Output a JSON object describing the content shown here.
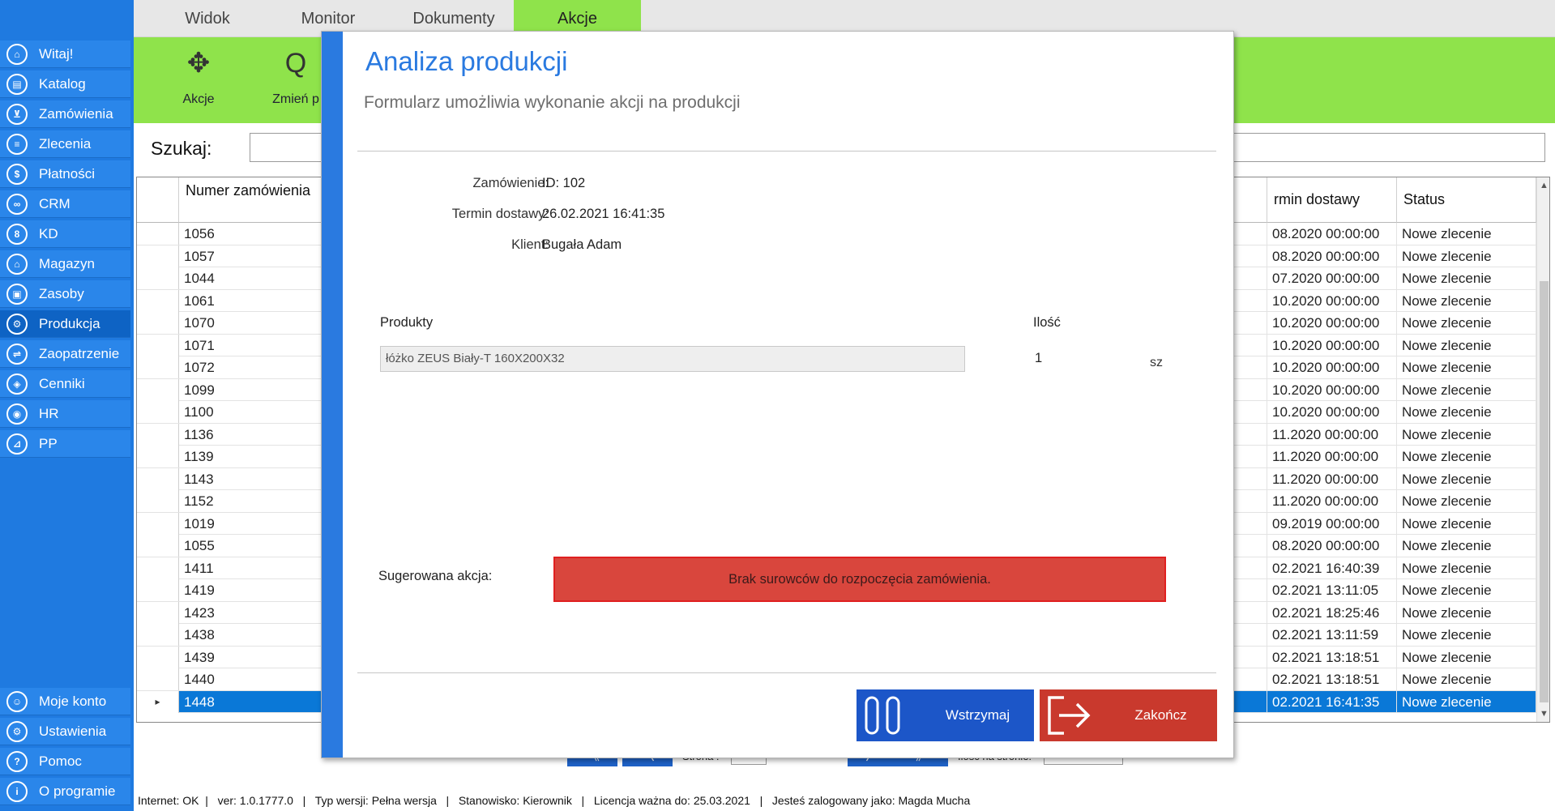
{
  "sidebar": {
    "items": [
      {
        "label": "Witaj!",
        "icon": "home-icon",
        "glyph": "⌂"
      },
      {
        "label": "Katalog",
        "icon": "book-icon",
        "glyph": "▤"
      },
      {
        "label": "Zamówienia",
        "icon": "cart-icon",
        "glyph": "⊻"
      },
      {
        "label": "Zlecenia",
        "icon": "list-icon",
        "glyph": "≡"
      },
      {
        "label": "Płatności",
        "icon": "dollar-icon",
        "glyph": "$"
      },
      {
        "label": "CRM",
        "icon": "crm-icon",
        "glyph": "∞"
      },
      {
        "label": "KD",
        "icon": "user-badge-icon",
        "glyph": "8"
      },
      {
        "label": "Magazyn",
        "icon": "warehouse-icon",
        "glyph": "⌂"
      },
      {
        "label": "Zasoby",
        "icon": "box-icon",
        "glyph": "▣"
      },
      {
        "label": "Produkcja",
        "icon": "production-icon",
        "glyph": "⚙"
      },
      {
        "label": "Zaopatrzenie",
        "icon": "truck-icon",
        "glyph": "⇌"
      },
      {
        "label": "Cenniki",
        "icon": "tag-icon",
        "glyph": "◈"
      },
      {
        "label": "HR",
        "icon": "hr-icon",
        "glyph": "◉"
      },
      {
        "label": "PP",
        "icon": "pp-icon",
        "glyph": "⊿"
      }
    ],
    "bottom_items": [
      {
        "label": "Moje konto",
        "icon": "account-icon",
        "glyph": "☺"
      },
      {
        "label": "Ustawienia",
        "icon": "settings-icon",
        "glyph": "⚙"
      },
      {
        "label": "Pomoc",
        "icon": "help-icon",
        "glyph": "?"
      },
      {
        "label": "O programie",
        "icon": "info-icon",
        "glyph": "i"
      }
    ]
  },
  "menubar": {
    "tabs": [
      {
        "label": "Widok"
      },
      {
        "label": "Monitor"
      },
      {
        "label": "Dokumenty"
      },
      {
        "label": "Akcje"
      }
    ]
  },
  "ribbon": {
    "actions_label": "Akcje",
    "actions_glyph": "✥",
    "change_label": "Zmień p",
    "change_glyph": "Q"
  },
  "search": {
    "label": "Szukaj:",
    "value": ""
  },
  "table": {
    "col_number_header": "Numer zamówienia",
    "col_delivery_header": "rmin dostawy",
    "col_status_header": "Status",
    "rows": [
      {
        "number": "1056",
        "delivery": "08.2020 00:00:00",
        "status": "Nowe zlecenie"
      },
      {
        "number": "1057",
        "delivery": "08.2020 00:00:00",
        "status": "Nowe zlecenie"
      },
      {
        "number": "1044",
        "delivery": "07.2020 00:00:00",
        "status": "Nowe zlecenie"
      },
      {
        "number": "1061",
        "delivery": "10.2020 00:00:00",
        "status": "Nowe zlecenie"
      },
      {
        "number": "1070",
        "delivery": "10.2020 00:00:00",
        "status": "Nowe zlecenie"
      },
      {
        "number": "1071",
        "delivery": "10.2020 00:00:00",
        "status": "Nowe zlecenie"
      },
      {
        "number": "1072",
        "delivery": "10.2020 00:00:00",
        "status": "Nowe zlecenie"
      },
      {
        "number": "1099",
        "delivery": "10.2020 00:00:00",
        "status": "Nowe zlecenie"
      },
      {
        "number": "1100",
        "delivery": "10.2020 00:00:00",
        "status": "Nowe zlecenie"
      },
      {
        "number": "1136",
        "delivery": "11.2020 00:00:00",
        "status": "Nowe zlecenie"
      },
      {
        "number": "1139",
        "delivery": "11.2020 00:00:00",
        "status": "Nowe zlecenie"
      },
      {
        "number": "1143",
        "delivery": "11.2020 00:00:00",
        "status": "Nowe zlecenie"
      },
      {
        "number": "1152",
        "delivery": "11.2020 00:00:00",
        "status": "Nowe zlecenie"
      },
      {
        "number": "1019",
        "delivery": "09.2019 00:00:00",
        "status": "Nowe zlecenie"
      },
      {
        "number": "1055",
        "delivery": "08.2020 00:00:00",
        "status": "Nowe zlecenie"
      },
      {
        "number": "1411",
        "delivery": "02.2021 16:40:39",
        "status": "Nowe zlecenie"
      },
      {
        "number": "1419",
        "delivery": "02.2021 13:11:05",
        "status": "Nowe zlecenie"
      },
      {
        "number": "1423",
        "delivery": "02.2021 18:25:46",
        "status": "Nowe zlecenie"
      },
      {
        "number": "1438",
        "delivery": "02.2021 13:11:59",
        "status": "Nowe zlecenie"
      },
      {
        "number": "1439",
        "delivery": "02.2021 13:18:51",
        "status": "Nowe zlecenie"
      },
      {
        "number": "1440",
        "delivery": "02.2021 13:18:51",
        "status": "Nowe zlecenie"
      },
      {
        "number": "1448",
        "delivery": "02.2021 16:41:35",
        "status": "Nowe zlecenie",
        "selected": true
      }
    ],
    "selected_row_marker": "▸"
  },
  "pager": {
    "first_glyph": "《",
    "prev_glyph": "〈",
    "next_glyph": "〉",
    "last_glyph": "》",
    "page_label": "Strona :",
    "per_page_label": "Ilość na stronie:"
  },
  "statusbar": {
    "text": "Internet: OK  |   ver: 1.0.1777.0   |   Typ wersji: Pełna wersja   |   Stanowisko: Kierownik   |   Licencja ważna do: 25.03.2021   |   Jesteś zalogowany jako: Magda Mucha"
  },
  "modal": {
    "title": "Analiza produkcji",
    "subtitle": "Formularz umożliwia wykonanie akcji na produkcji",
    "order_label": "Zamówienie:",
    "order_value": "ID: 102",
    "delivery_label": "Termin dostawy:",
    "delivery_value": "26.02.2021 16:41:35",
    "client_label": "Klient:",
    "client_value": "Bugała Adam",
    "products_header": "Produkty",
    "quantity_header": "Ilość",
    "product_value": "łóżko ZEUS Biały-T 160X200X32",
    "quantity_value": "1",
    "unit_value": "sz",
    "suggested_label": "Sugerowana akcja:",
    "suggested_action": "Brak surowców do rozpoczęcia zamówienia.",
    "pause_label": "Wstrzymaj",
    "finish_label": "Zakończ"
  },
  "colors": {
    "sidebar_blue": "#1f7ae0",
    "ribbon_green": "#8fe34b",
    "selected_row": "#0a78d7",
    "alert_red": "#d9463d",
    "pause_blue": "#1c56c8",
    "finish_red": "#c9392d"
  }
}
